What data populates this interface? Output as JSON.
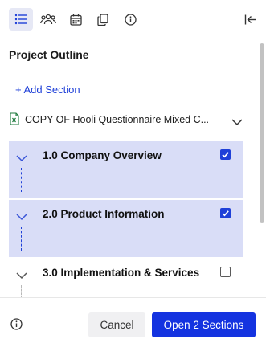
{
  "toolbar": {
    "icons": [
      "outline-list-icon",
      "team-icon",
      "calendar-icon",
      "copy-icon",
      "info-icon",
      "collapse-panel-icon"
    ]
  },
  "panel": {
    "title": "Project Outline",
    "add_section_label": "+ Add Section"
  },
  "document": {
    "name": "COPY OF Hooli Questionnaire Mixed C...",
    "icon": "excel-file-icon"
  },
  "sections": [
    {
      "label": "1.0 Company Overview",
      "checked": true,
      "selected": true
    },
    {
      "label": "2.0 Product Information",
      "checked": true,
      "selected": true
    },
    {
      "label": "3.0 Implementation & Services",
      "checked": false,
      "selected": false
    }
  ],
  "footer": {
    "cancel_label": "Cancel",
    "open_label": "Open 2 Sections"
  },
  "colors": {
    "accent": "#1433e0",
    "selected_row": "#d9ddf7",
    "link": "#1f40d8"
  }
}
